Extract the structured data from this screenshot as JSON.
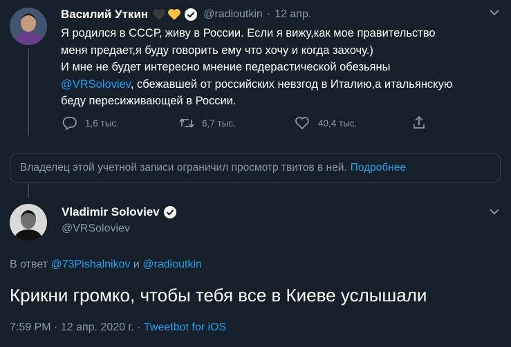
{
  "tweet1": {
    "author_name": "Василий Уткин",
    "handle": "@radioutkin",
    "separator": "·",
    "date": "12 апр.",
    "lines": [
      "Я родился в СССР, живу в России. Если я вижу,как мое правительство",
      "меня предает,я буду говорить ему что хочу и когда захочу.)",
      "И мне не будет интересно мнение педерастической обезьяны"
    ],
    "mention": "@VRSoloviev",
    "line4_rest": ", сбежавшей от российских невзгод в Италию,а итальянскую",
    "line5": "беду пересиживающей в России.",
    "actions": {
      "reply_count": "1,6 тыс.",
      "retweet_count": "6,7 тыс.",
      "like_count": "40,4 тыс."
    }
  },
  "notice": {
    "text": "Владелец этой учетной записи ограничил просмотр твитов в ней.",
    "link": "Подробнее"
  },
  "tweet2": {
    "author_name": "Vladimir Soloviev",
    "handle": "@VRSoloviev",
    "reply_prefix": "В ответ",
    "reply_user1": "@73Pishalnikov",
    "reply_and": "и",
    "reply_user2": "@radioutkin",
    "text": "Крикни громко, чтобы тебя все в Киеве услышали",
    "time": "7:59 PM",
    "dot1": "·",
    "date": "12 апр. 2020 г.",
    "dot2": "·",
    "source": "Tweetbot for iOS"
  },
  "colors": {
    "background": "#15202b",
    "accent": "#1da1f2",
    "muted": "#8899a6",
    "heart_emoji": "#f6c343",
    "black_heart": "#3a3a3a"
  }
}
